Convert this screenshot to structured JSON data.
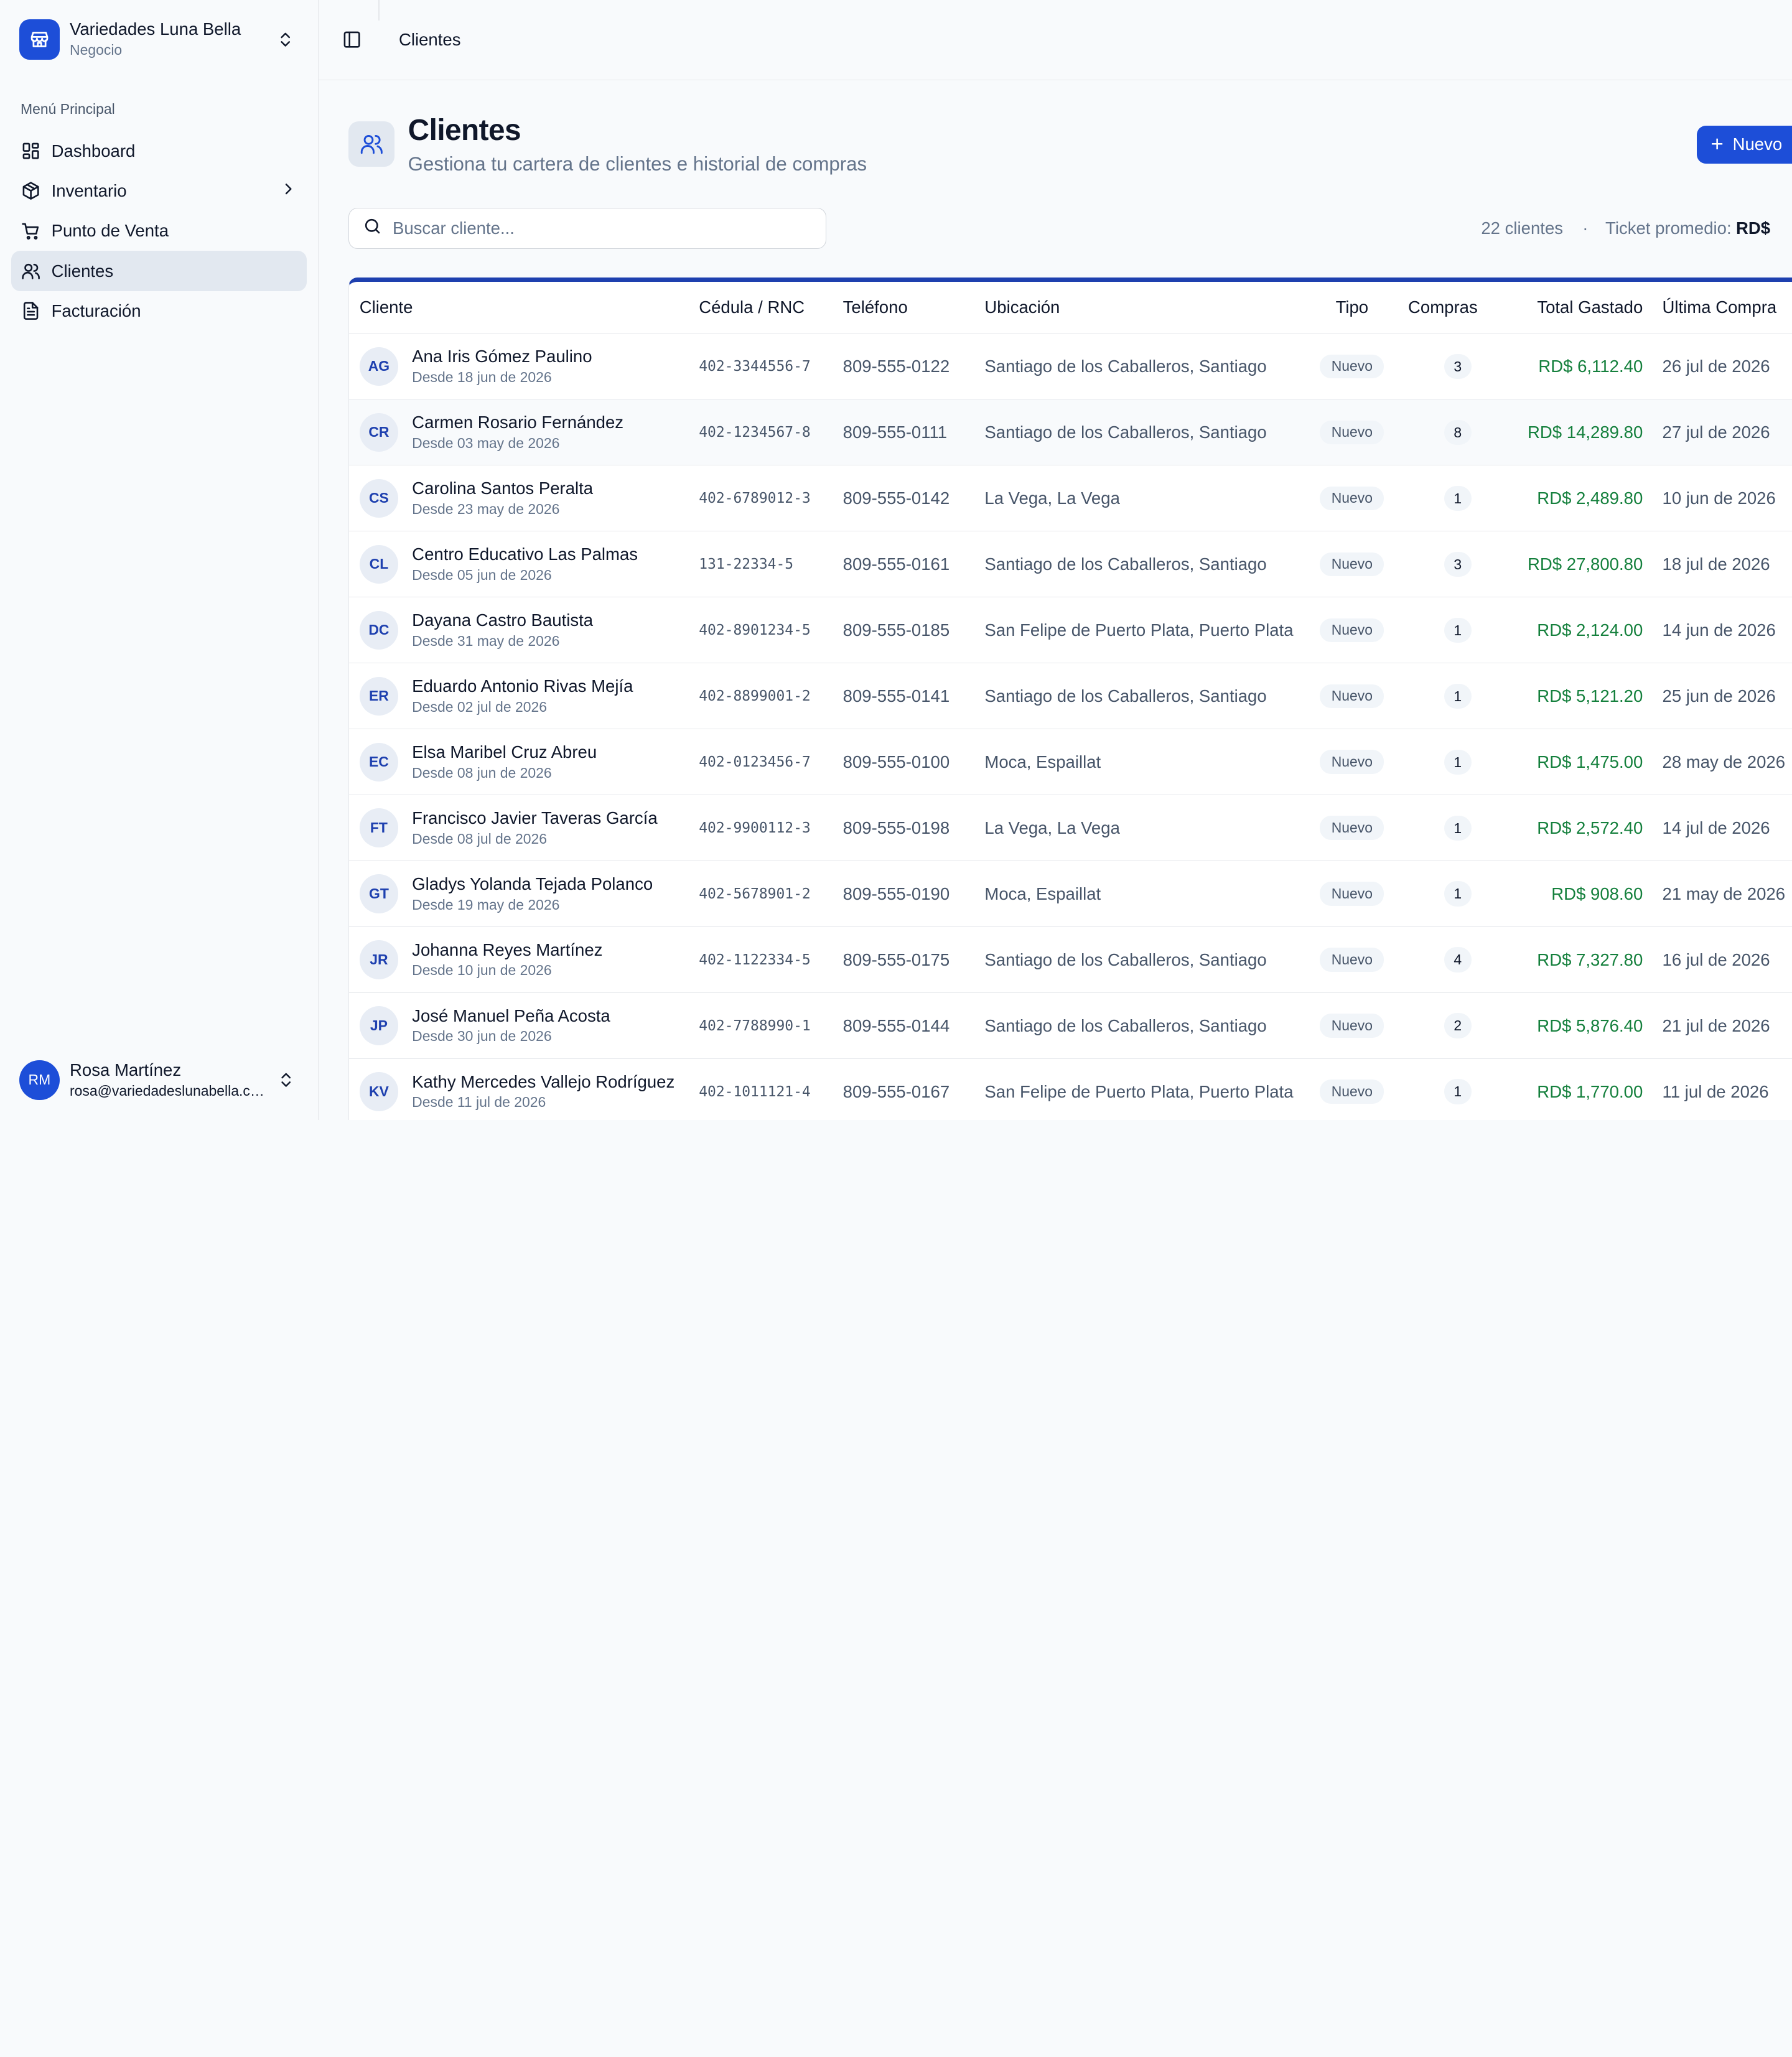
{
  "brand": {
    "name": "Variedades Luna Bella",
    "subtitle": "Negocio"
  },
  "menu_label": "Menú Principal",
  "nav": [
    {
      "label": "Dashboard",
      "icon": "dashboard-icon"
    },
    {
      "label": "Inventario",
      "icon": "package-icon"
    },
    {
      "label": "Punto de Venta",
      "icon": "cart-icon"
    },
    {
      "label": "Clientes",
      "icon": "users-icon",
      "active": true
    },
    {
      "label": "Facturación",
      "icon": "file-text-icon"
    }
  ],
  "user": {
    "initials": "RM",
    "name": "Rosa Martínez",
    "email": "rosa@variedadeslunabella.com"
  },
  "topbar": {
    "breadcrumb": "Clientes"
  },
  "page": {
    "title": "Clientes",
    "subtitle": "Gestiona tu cartera de clientes e historial de compras",
    "new_button": "Nuevo"
  },
  "search": {
    "placeholder": "Buscar cliente..."
  },
  "stats": {
    "count_text": "22 clientes",
    "separator": "·",
    "ticket_label": "Ticket promedio:",
    "ticket_value": "RD$"
  },
  "table": {
    "headers": {
      "cliente": "Cliente",
      "cedula": "Cédula / RNC",
      "telefono": "Teléfono",
      "ubicacion": "Ubicación",
      "tipo": "Tipo",
      "compras": "Compras",
      "total": "Total Gastado",
      "ultima": "Última Compra"
    },
    "rows": [
      {
        "initials": "AG",
        "name": "Ana Iris Gómez Paulino",
        "since": "Desde 18 jun de 2026",
        "cedula": "402-3344556-7",
        "telefono": "809-555-0122",
        "ubicacion": "Santiago de los Caballeros, Santiago",
        "tipo": "Nuevo",
        "compras": "3",
        "total": "RD$ 6,112.40",
        "ultima": "26 jul de 2026"
      },
      {
        "initials": "CR",
        "name": "Carmen Rosario Fernández",
        "since": "Desde 03 may de 2026",
        "cedula": "402-1234567-8",
        "telefono": "809-555-0111",
        "ubicacion": "Santiago de los Caballeros, Santiago",
        "tipo": "Nuevo",
        "compras": "8",
        "total": "RD$ 14,289.80",
        "ultima": "27 jul de 2026"
      },
      {
        "initials": "CS",
        "name": "Carolina Santos Peralta",
        "since": "Desde 23 may de 2026",
        "cedula": "402-6789012-3",
        "telefono": "809-555-0142",
        "ubicacion": "La Vega, La Vega",
        "tipo": "Nuevo",
        "compras": "1",
        "total": "RD$ 2,489.80",
        "ultima": "10 jun de 2026"
      },
      {
        "initials": "CL",
        "name": "Centro Educativo Las Palmas",
        "since": "Desde 05 jun de 2026",
        "cedula": "131-22334-5",
        "telefono": "809-555-0161",
        "ubicacion": "Santiago de los Caballeros, Santiago",
        "tipo": "Nuevo",
        "compras": "3",
        "total": "RD$ 27,800.80",
        "ultima": "18 jul de 2026"
      },
      {
        "initials": "DC",
        "name": "Dayana Castro Bautista",
        "since": "Desde 31 may de 2026",
        "cedula": "402-8901234-5",
        "telefono": "809-555-0185",
        "ubicacion": "San Felipe de Puerto Plata, Puerto Plata",
        "tipo": "Nuevo",
        "compras": "1",
        "total": "RD$ 2,124.00",
        "ultima": "14 jun de 2026"
      },
      {
        "initials": "ER",
        "name": "Eduardo Antonio Rivas Mejía",
        "since": "Desde 02 jul de 2026",
        "cedula": "402-8899001-2",
        "telefono": "809-555-0141",
        "ubicacion": "Santiago de los Caballeros, Santiago",
        "tipo": "Nuevo",
        "compras": "1",
        "total": "RD$ 5,121.20",
        "ultima": "25 jun de 2026"
      },
      {
        "initials": "EC",
        "name": "Elsa Maribel Cruz Abreu",
        "since": "Desde 08 jun de 2026",
        "cedula": "402-0123456-7",
        "telefono": "809-555-0100",
        "ubicacion": "Moca, Espaillat",
        "tipo": "Nuevo",
        "compras": "1",
        "total": "RD$ 1,475.00",
        "ultima": "28 may de 2026"
      },
      {
        "initials": "FT",
        "name": "Francisco Javier Taveras García",
        "since": "Desde 08 jul de 2026",
        "cedula": "402-9900112-3",
        "telefono": "809-555-0198",
        "ubicacion": "La Vega, La Vega",
        "tipo": "Nuevo",
        "compras": "1",
        "total": "RD$ 2,572.40",
        "ultima": "14 jul de 2026"
      },
      {
        "initials": "GT",
        "name": "Gladys Yolanda Tejada Polanco",
        "since": "Desde 19 may de 2026",
        "cedula": "402-5678901-2",
        "telefono": "809-555-0190",
        "ubicacion": "Moca, Espaillat",
        "tipo": "Nuevo",
        "compras": "1",
        "total": "RD$ 908.60",
        "ultima": "21 may de 2026"
      },
      {
        "initials": "JR",
        "name": "Johanna Reyes Martínez",
        "since": "Desde 10 jun de 2026",
        "cedula": "402-1122334-5",
        "telefono": "809-555-0175",
        "ubicacion": "Santiago de los Caballeros, Santiago",
        "tipo": "Nuevo",
        "compras": "4",
        "total": "RD$ 7,327.80",
        "ultima": "16 jul de 2026"
      },
      {
        "initials": "JP",
        "name": "José Manuel Peña Acosta",
        "since": "Desde 30 jun de 2026",
        "cedula": "402-7788990-1",
        "telefono": "809-555-0144",
        "ubicacion": "Santiago de los Caballeros, Santiago",
        "tipo": "Nuevo",
        "compras": "2",
        "total": "RD$ 5,876.40",
        "ultima": "21 jul de 2026"
      },
      {
        "initials": "KV",
        "name": "Kathy Mercedes Vallejo Rodríguez",
        "since": "Desde 11 jul de 2026",
        "cedula": "402-1011121-4",
        "telefono": "809-555-0167",
        "ubicacion": "San Felipe de Puerto Plata, Puerto Plata",
        "tipo": "Nuevo",
        "compras": "1",
        "total": "RD$ 1,770.00",
        "ultima": "11 jul de 2026"
      }
    ]
  },
  "colors": {
    "accent": "#1d4ed8",
    "money": "#15803d",
    "sidebar_active": "#e2e8f0"
  }
}
